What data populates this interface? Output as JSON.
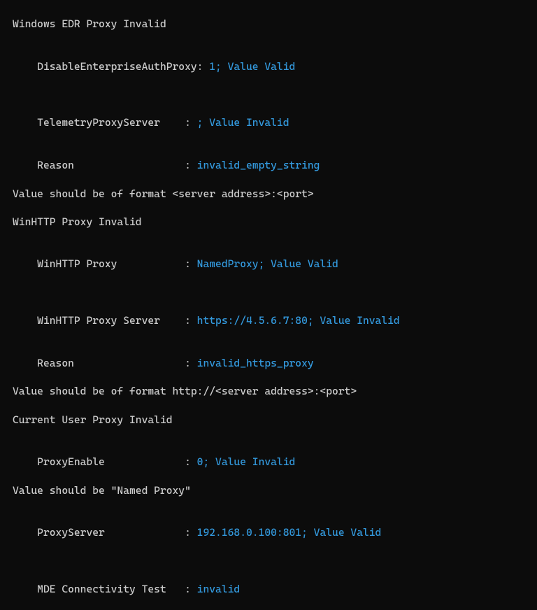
{
  "sections": {
    "edr_header": "Windows EDR Proxy Invalid",
    "disable_auth": {
      "label": "DisableEnterpriseAuthProxy: ",
      "value": "1; Value Valid"
    },
    "telemetry": {
      "label": "TelemetryProxyServer    : ",
      "value": "; Value Invalid"
    },
    "telemetry_reason": {
      "label": "Reason                  : ",
      "value": "invalid_empty_string"
    },
    "telemetry_hint": "Value should be of format <server address>:<port>",
    "winhttp_header": "WinHTTP Proxy Invalid",
    "winhttp_proxy": {
      "label": "WinHTTP Proxy           : ",
      "value": "NamedProxy; Value Valid"
    },
    "winhttp_server": {
      "label": "WinHTTP Proxy Server    : ",
      "value": "https://4.5.6.7:80; Value Invalid"
    },
    "winhttp_reason": {
      "label": "Reason                  : ",
      "value": "invalid_https_proxy"
    },
    "winhttp_hint": "Value should be of format http://<server address>:<port>",
    "user_header": "Current User Proxy Invalid",
    "proxy_enable": {
      "label": "ProxyEnable             : ",
      "value": "0; Value Invalid"
    },
    "proxy_enable_hint": "Value should be \"Named Proxy\"",
    "proxy_server": {
      "label": "ProxyServer             : ",
      "value": "192.168.0.100:801; Value Valid"
    },
    "mde_test": {
      "label": "MDE Connectivity Test   : ",
      "value": "invalid"
    }
  }
}
